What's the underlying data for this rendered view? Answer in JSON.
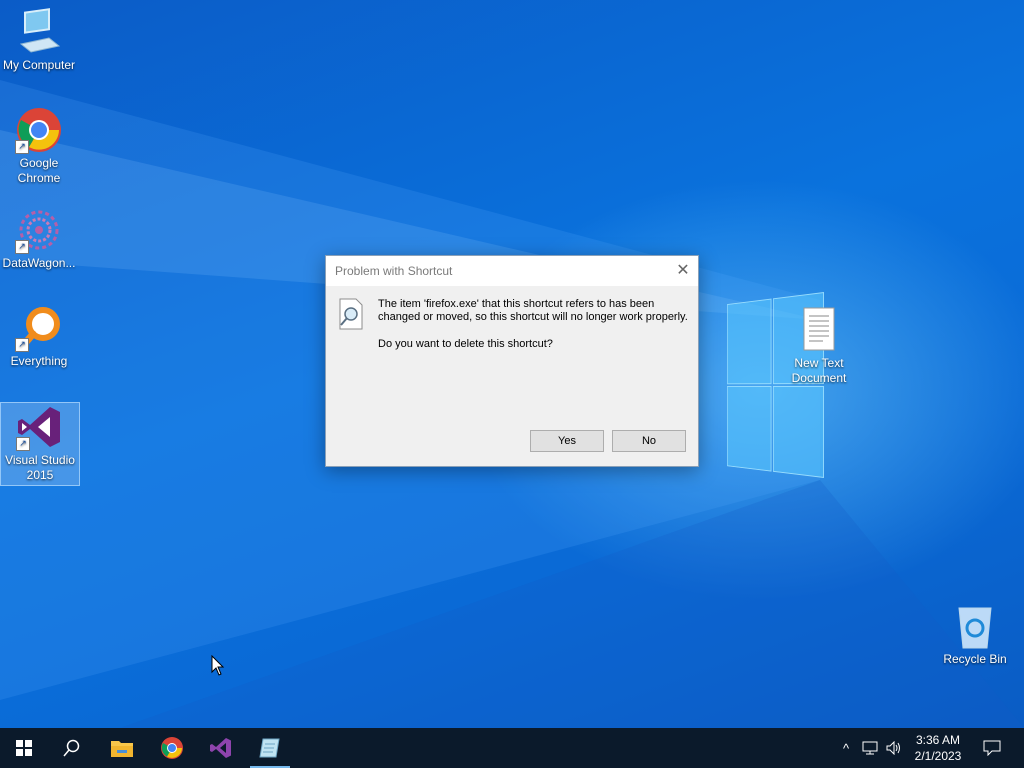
{
  "desktop": {
    "icons": [
      {
        "label": "My Computer"
      },
      {
        "label": "Google Chrome"
      },
      {
        "label": "DataWagon..."
      },
      {
        "label": "Everything"
      },
      {
        "label": "Visual Studio 2015"
      },
      {
        "label": "New Text Document"
      },
      {
        "label": "Recycle Bin"
      }
    ]
  },
  "dialog": {
    "title": "Problem with Shortcut",
    "message": "The item 'firefox.exe' that this shortcut refers to has been changed or moved, so this shortcut will no longer work properly.",
    "question": "Do you want to delete this shortcut?",
    "yes_label": "Yes",
    "no_label": "No",
    "close_glyph": "✕"
  },
  "taskbar": {
    "time": "3:36 AM",
    "date": "2/1/2023"
  },
  "colors": {
    "accent": "#76b9ed",
    "taskbar": "#0b1a2b",
    "desktop": "#0a6fd6"
  }
}
